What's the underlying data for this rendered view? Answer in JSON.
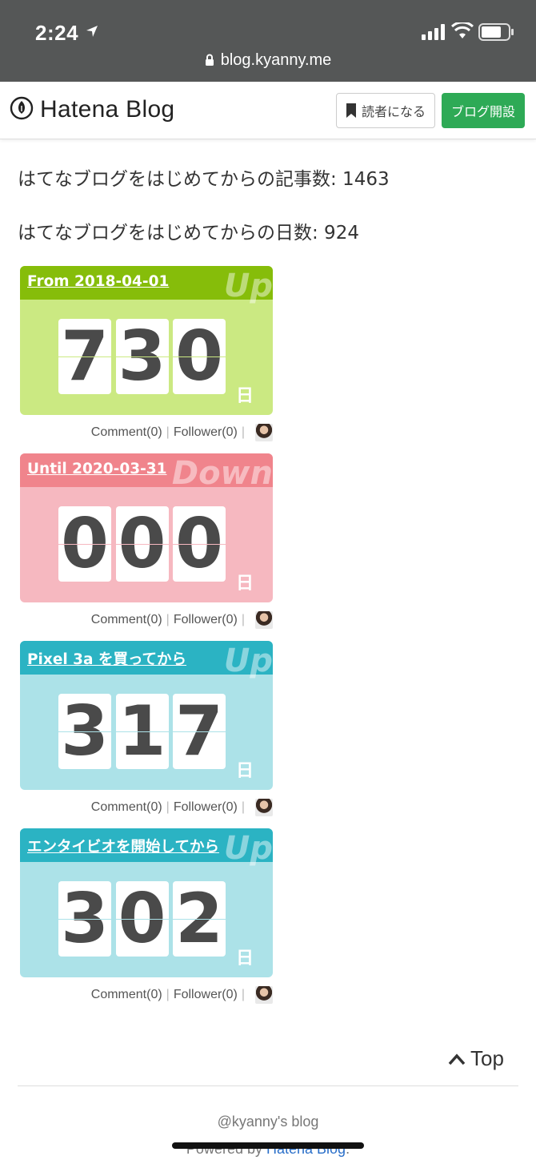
{
  "status_bar": {
    "time": "2:24",
    "url": "blog.kyanny.me"
  },
  "header": {
    "logo_text": "Hatena Blog",
    "reader_button": "読者になる",
    "open_blog_button": "ブログ開設"
  },
  "stats": {
    "articles": "はてなブログをはじめてからの記事数: 1463",
    "days": "はてなブログをはじめてからの日数: 924"
  },
  "counters": [
    {
      "title": "From 2018-04-01",
      "watermark": "Up",
      "digits": [
        "7",
        "3",
        "0"
      ],
      "unit": "日",
      "head_color": "#86bd0a",
      "body_color": "#cbe982",
      "line_color": "#cbe982"
    },
    {
      "title": "Until 2020-03-31",
      "watermark": "Down",
      "digits": [
        "0",
        "0",
        "0"
      ],
      "unit": "日",
      "head_color": "#f0848c",
      "body_color": "#f6b8c0",
      "line_color": "#f6b8c0"
    },
    {
      "title": "Pixel 3a を買ってから",
      "watermark": "Up",
      "digits": [
        "3",
        "1",
        "7"
      ],
      "unit": "日",
      "head_color": "#2bb3c3",
      "body_color": "#ace2e8",
      "line_color": "#ace2e8"
    },
    {
      "title": "エンタイビオを開始してから",
      "watermark": "Up",
      "digits": [
        "3",
        "0",
        "2"
      ],
      "unit": "日",
      "head_color": "#2bb3c3",
      "body_color": "#ace2e8",
      "line_color": "#ace2e8"
    }
  ],
  "counter_meta": {
    "comment": "Comment(0)",
    "follower": "Follower(0)"
  },
  "footer": {
    "go_top": "Top",
    "blog_name": "@kyanny's blog",
    "powered_prefix": "Powered by ",
    "powered_link": "Hatena Blog",
    "powered_suffix": "."
  }
}
